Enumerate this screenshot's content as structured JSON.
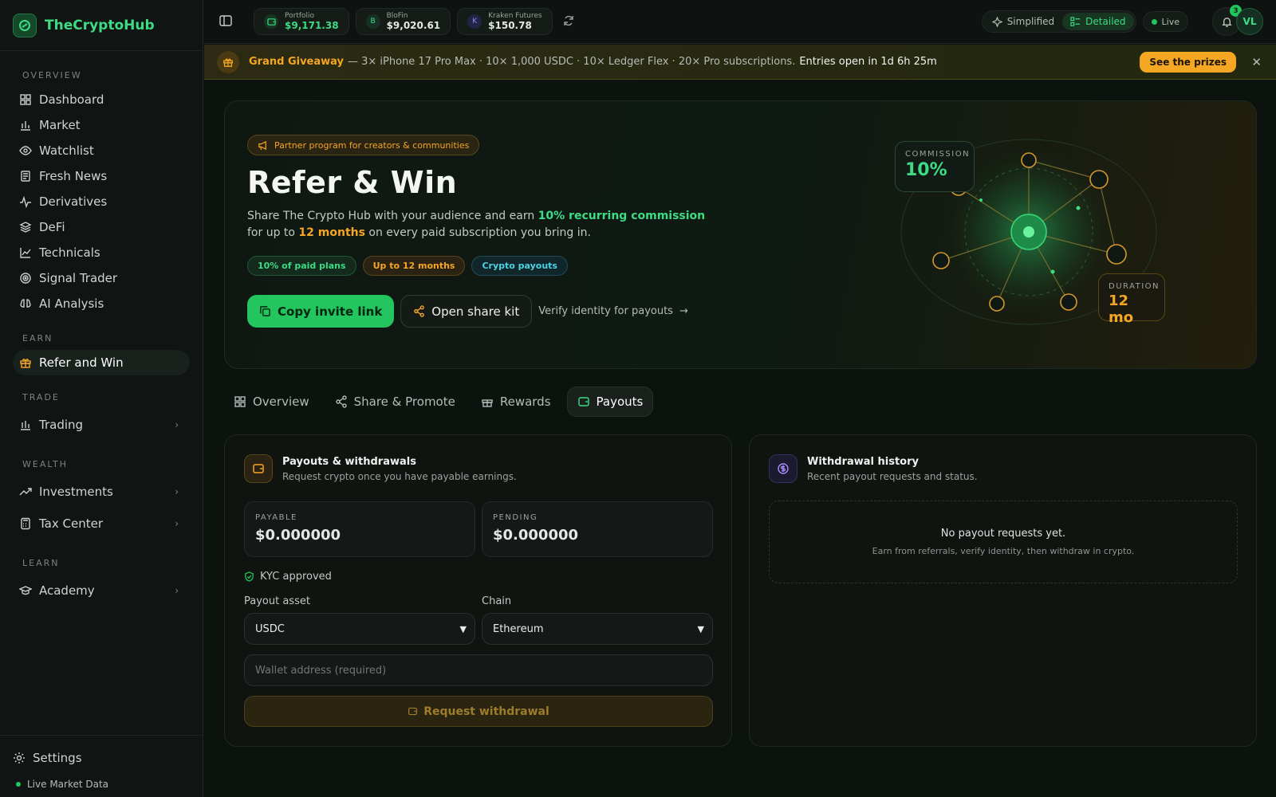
{
  "brand": {
    "name": "TheCryptoHub"
  },
  "sidebar": {
    "overview_label": "OVERVIEW",
    "overview_items": [
      {
        "label": "Dashboard",
        "icon": "dashboard-icon"
      },
      {
        "label": "Market",
        "icon": "market-icon"
      },
      {
        "label": "Watchlist",
        "icon": "eye-icon"
      },
      {
        "label": "Fresh News",
        "icon": "news-icon"
      },
      {
        "label": "Derivatives",
        "icon": "activity-icon"
      },
      {
        "label": "DeFi",
        "icon": "layers-icon"
      },
      {
        "label": "Technicals",
        "icon": "chart-line-icon"
      },
      {
        "label": "Signal Trader",
        "icon": "target-icon"
      },
      {
        "label": "AI Analysis",
        "icon": "brain-icon"
      }
    ],
    "earn_label": "EARN",
    "earn_item": "Refer and Win",
    "trade_label": "TRADE",
    "trade_item": "Trading",
    "wealth_label": "WEALTH",
    "wealth_items": [
      "Investments",
      "Tax Center"
    ],
    "learn_label": "LEARN",
    "learn_item": "Academy",
    "settings": "Settings",
    "live_data": "Live Market Data"
  },
  "topbar": {
    "accounts": [
      {
        "name": "Portfolio",
        "value": "$9,171.38"
      },
      {
        "name": "BloFin",
        "value": "$9,020.61",
        "badge": "B"
      },
      {
        "name": "Kraken Futures",
        "value": "$150.78",
        "badge": "K"
      }
    ],
    "view_simplified": "Simplified",
    "view_detailed": "Detailed",
    "live": "Live",
    "notifications": "3",
    "avatar": "VL"
  },
  "promo": {
    "title": "Grand Giveaway",
    "text": "— 3× iPhone 17 Pro Max · 10× 1,000 USDC · 10× Ledger Flex · 20× Pro subscriptions.",
    "countdown": "Entries open in 1d 6h 25m",
    "cta": "See the prizes"
  },
  "hero": {
    "badge": "Partner program for creators & communities",
    "title": "Refer & Win",
    "desc_1": "Share The Crypto Hub with your audience and earn",
    "desc_hl1": "10% recurring commission",
    "desc_2": "for up to",
    "desc_hl2": "12 months",
    "desc_3": "on every paid subscription you bring in.",
    "pills": [
      "10% of paid plans",
      "Up to 12 months",
      "Crypto payouts"
    ],
    "copy_btn": "Copy invite link",
    "share_btn": "Open share kit",
    "verify_link": "Verify identity for payouts",
    "commission_label": "COMMISSION",
    "commission_value": "10%",
    "duration_label": "DURATION",
    "duration_value": "12 mo"
  },
  "tabs": [
    "Overview",
    "Share & Promote",
    "Rewards",
    "Payouts"
  ],
  "payouts": {
    "title": "Payouts & withdrawals",
    "subtitle": "Request crypto once you have payable earnings.",
    "payable_label": "PAYABLE",
    "payable_value": "$0.000000",
    "pending_label": "PENDING",
    "pending_value": "$0.000000",
    "kyc": "KYC approved",
    "asset_label": "Payout asset",
    "asset_value": "USDC",
    "chain_label": "Chain",
    "chain_value": "Ethereum",
    "wallet_placeholder": "Wallet address (required)",
    "submit": "Request withdrawal"
  },
  "history": {
    "title": "Withdrawal history",
    "subtitle": "Recent payout requests and status.",
    "empty_title": "No payout requests yet.",
    "empty_sub": "Earn from referrals, verify identity, then withdraw in crypto."
  },
  "colors": {
    "accent": "#22c55e",
    "warn": "#f5a623",
    "bg": "#0c120e"
  }
}
